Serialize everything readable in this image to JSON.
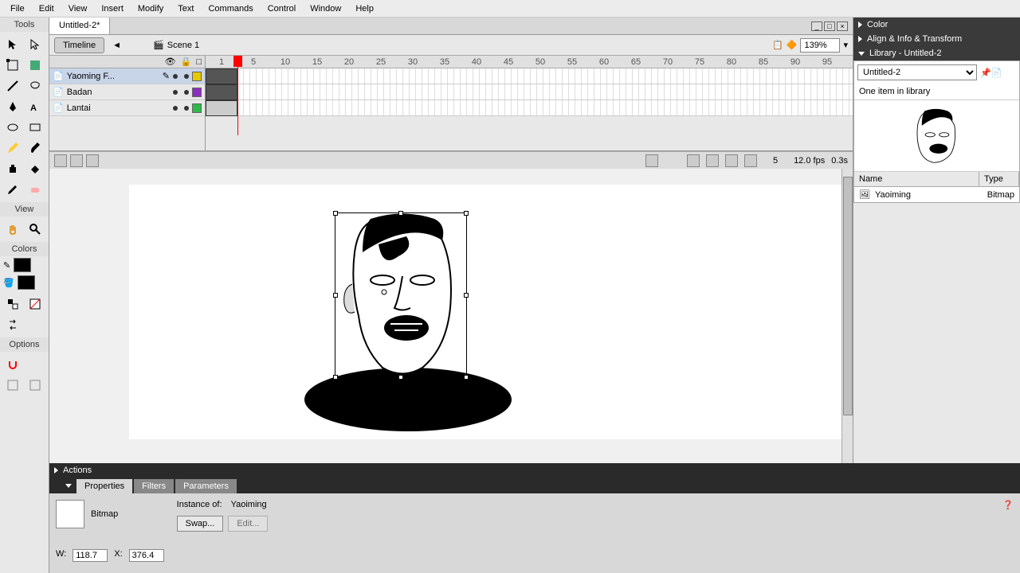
{
  "menu": {
    "file": "File",
    "edit": "Edit",
    "view": "View",
    "insert": "Insert",
    "modify": "Modify",
    "text": "Text",
    "commands": "Commands",
    "control": "Control",
    "window": "Window",
    "help": "Help"
  },
  "tools_title": "Tools",
  "view_title": "View",
  "colors_title": "Colors",
  "options_title": "Options",
  "doc": {
    "tab": "Untitled-2*",
    "timeline": "Timeline",
    "scene": "Scene 1",
    "zoom": "139%"
  },
  "timeline": {
    "layers": [
      {
        "name": "Yaoming F...",
        "color": "#e6c800"
      },
      {
        "name": "Badan",
        "color": "#8b2fbf"
      },
      {
        "name": "Lantai",
        "color": "#2fb84a"
      }
    ],
    "ticks": [
      "1",
      "5",
      "10",
      "15",
      "20",
      "25",
      "30",
      "35",
      "40",
      "45",
      "50",
      "55",
      "60",
      "65",
      "70",
      "75",
      "80",
      "85",
      "90",
      "95"
    ],
    "footer": {
      "frame": "5",
      "fps": "12.0 fps",
      "time": "0.3s"
    }
  },
  "right": {
    "color": "Color",
    "align": "Align & Info & Transform",
    "library_title": "Library - Untitled-2",
    "lib_select": "Untitled-2",
    "lib_info": "One item in library",
    "cols": {
      "name": "Name",
      "type": "Type"
    },
    "row": {
      "name": "Yaoiming",
      "type": "Bitmap"
    }
  },
  "bottom": {
    "actions": "Actions",
    "tabs": {
      "properties": "Properties",
      "filters": "Filters",
      "parameters": "Parameters"
    },
    "type": "Bitmap",
    "instance_label": "Instance of:",
    "instance_value": "Yaoiming",
    "swap": "Swap...",
    "edit": "Edit...",
    "dims": {
      "w_label": "W:",
      "w": "118.7",
      "x_label": "X:",
      "x": "376.4"
    }
  }
}
